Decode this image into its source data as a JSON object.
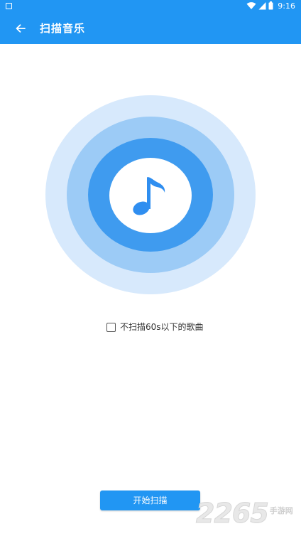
{
  "status_bar": {
    "time": "9:16",
    "icons": [
      "app-notification-icon",
      "wifi-icon",
      "cell-signal-icon",
      "battery-icon"
    ]
  },
  "toolbar": {
    "back_icon": "arrow-left-icon",
    "title": "扫描音乐"
  },
  "scan_graphic": {
    "icon": "music-note-icon",
    "colors": {
      "outer": "#d7e9fc",
      "middle": "#9ccbf6",
      "inner": "#3f9bef",
      "note": "#2f8ef0"
    }
  },
  "filter_option": {
    "label": "不扫描60s以下的歌曲",
    "checked": false
  },
  "actions": {
    "start_scan_label": "开始扫描"
  },
  "watermark": {
    "number": "2265",
    "text": "手游网"
  },
  "theme": {
    "primary": "#2196f3"
  }
}
